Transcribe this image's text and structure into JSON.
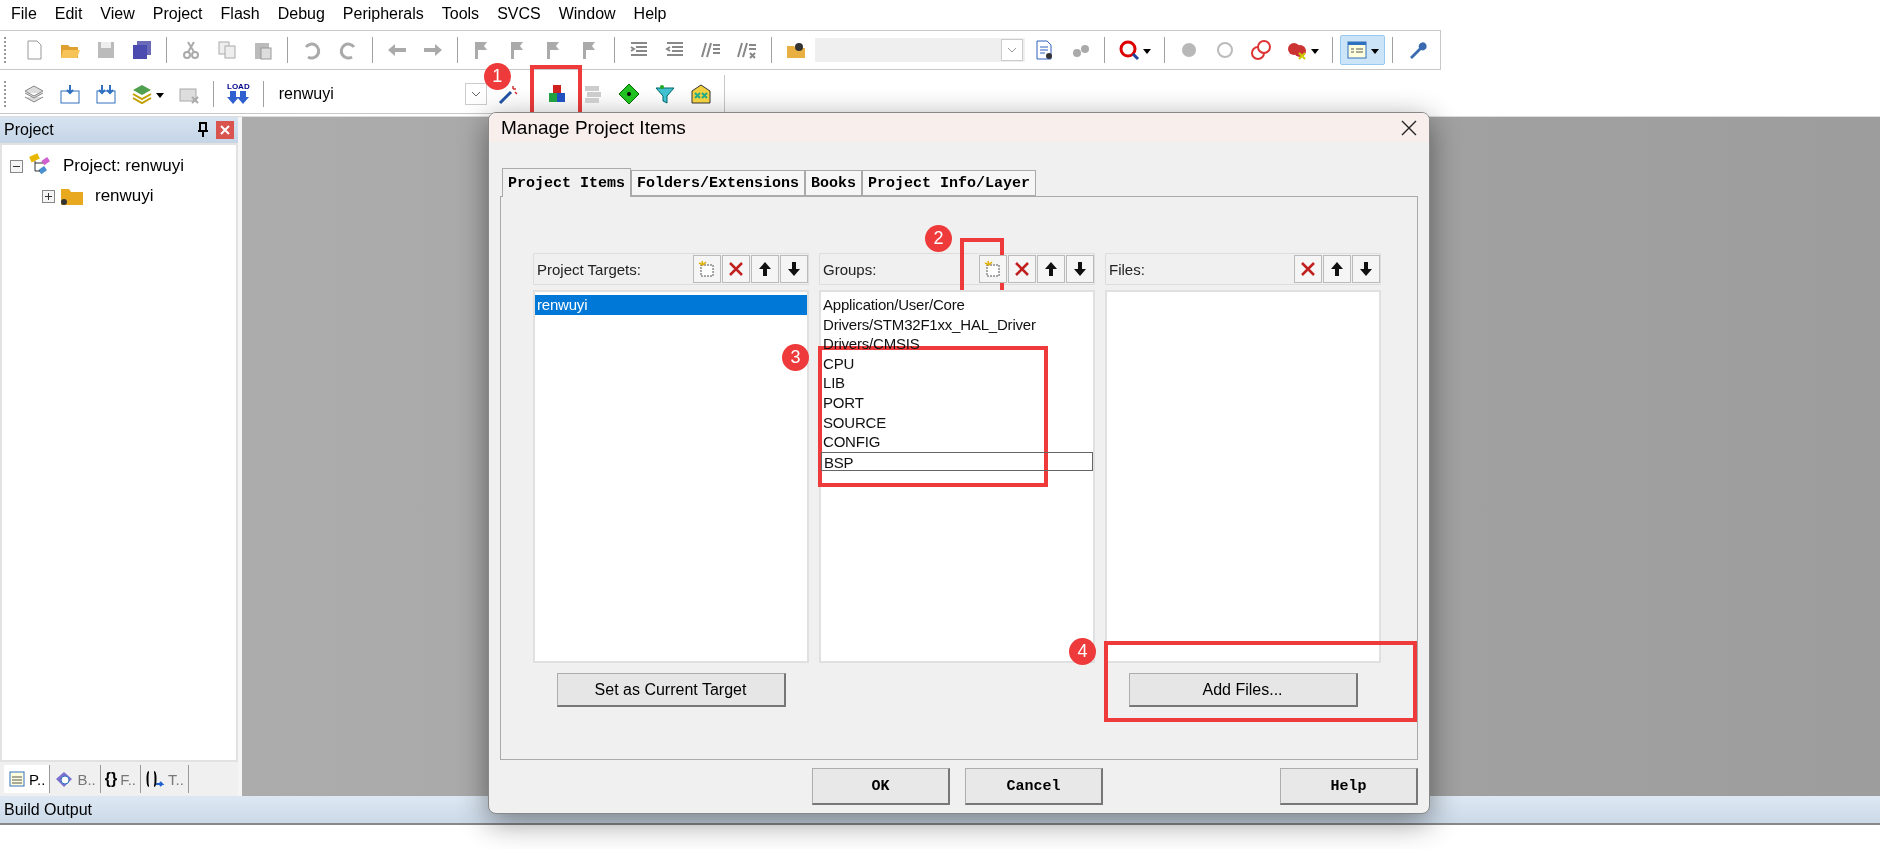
{
  "menu": [
    "File",
    "Edit",
    "View",
    "Project",
    "Flash",
    "Debug",
    "Peripherals",
    "Tools",
    "SVCS",
    "Window",
    "Help"
  ],
  "toolbar": {
    "load_label": "LOAD",
    "target": "renwuyi"
  },
  "project_panel": {
    "title": "Project",
    "tree": [
      {
        "label": "Project: renwuyi",
        "expanded": true,
        "children": [
          {
            "label": "renwuyi",
            "expanded": false
          }
        ]
      }
    ],
    "tabs": [
      {
        "kind": "project",
        "label": "P..",
        "selected": true
      },
      {
        "kind": "books",
        "label": "B..",
        "selected": false
      },
      {
        "kind": "functions",
        "glyph": "{}",
        "label": "F..",
        "selected": false
      },
      {
        "kind": "templates",
        "label": "T..",
        "selected": false
      }
    ]
  },
  "dialog": {
    "title": "Manage Project Items",
    "tabs": [
      {
        "label": "Project Items",
        "selected": true
      },
      {
        "label": "Folders/Extensions",
        "selected": false
      },
      {
        "label": "Books",
        "selected": false
      },
      {
        "label": "Project Info/Layer",
        "selected": false
      }
    ],
    "columns": [
      {
        "label": "Project Targets:",
        "tools": [
          {
            "kind": "new"
          },
          {
            "kind": "delete"
          },
          {
            "kind": "up"
          },
          {
            "kind": "down"
          }
        ],
        "items": [
          {
            "label": "renwuyi",
            "selected": true,
            "focused": false
          }
        ],
        "button": "Set as Current Target"
      },
      {
        "label": "Groups:",
        "tools": [
          {
            "kind": "new"
          },
          {
            "kind": "delete"
          },
          {
            "kind": "up"
          },
          {
            "kind": "down"
          }
        ],
        "items": [
          {
            "label": "Application/User/Core",
            "selected": false,
            "focused": false
          },
          {
            "label": "Drivers/STM32F1xx_HAL_Driver",
            "selected": false,
            "focused": false
          },
          {
            "label": "Drivers/CMSIS",
            "selected": false,
            "focused": false
          },
          {
            "label": "CPU",
            "selected": false,
            "focused": false
          },
          {
            "label": "LIB",
            "selected": false,
            "focused": false
          },
          {
            "label": "PORT",
            "selected": false,
            "focused": false
          },
          {
            "label": "SOURCE",
            "selected": false,
            "focused": false
          },
          {
            "label": "CONFIG",
            "selected": false,
            "focused": false
          },
          {
            "label": "BSP",
            "selected": false,
            "focused": true
          }
        ]
      },
      {
        "label": "Files:",
        "tools": [
          {
            "kind": "delete"
          },
          {
            "kind": "up"
          },
          {
            "kind": "down"
          }
        ],
        "button": "Add Files..."
      }
    ],
    "buttons": [
      "OK",
      "Cancel",
      "Help"
    ]
  },
  "build_output": {
    "title": "Build Output"
  },
  "annotations": [
    "1",
    "2",
    "3",
    "4"
  ]
}
